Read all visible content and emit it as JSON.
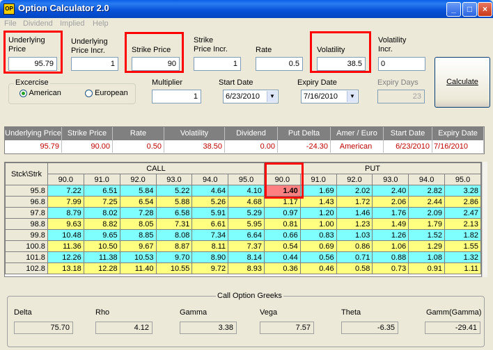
{
  "window": {
    "title": "Option Calculator 2.0",
    "icon_text": "OP",
    "minimize_icon": "minimize-icon",
    "maximize_icon": "maximize-icon",
    "close_icon": "close-icon"
  },
  "menu": [
    "File",
    "Dividend",
    "Implied",
    "Help"
  ],
  "inputs": {
    "underlying_price": {
      "label_line1": "Underlying",
      "label_line2": "Price",
      "value": "95.79"
    },
    "underlying_price_incr": {
      "label_line1": "Underlying",
      "label_line2": "Price Incr.",
      "value": "1"
    },
    "strike_price": {
      "label": "Strike Price",
      "value": "90"
    },
    "strike_price_incr": {
      "label_line1": "Strike",
      "label_line2": "Price Incr.",
      "value": "1"
    },
    "rate": {
      "label": "Rate",
      "value": "0.5"
    },
    "volatility": {
      "label": "Volatility",
      "value": "38.5"
    },
    "volatility_incr": {
      "label_line1": "Volatility",
      "label_line2": "Incr.",
      "value": "0"
    },
    "multiplier": {
      "label": "Multiplier",
      "value": "1"
    },
    "start_date": {
      "label": "Start Date",
      "value": "6/23/2010"
    },
    "expiry_date": {
      "label": "Expiry Date",
      "value": "7/16/2010"
    },
    "expiry_days": {
      "label": "Expiry Days",
      "value": "23"
    }
  },
  "exercise": {
    "label": "Excercise",
    "american": "American",
    "european": "European",
    "selected": "American"
  },
  "calculate_label": "Calculate",
  "summary": {
    "headers": [
      "Underlying Price",
      "Strike Price",
      "Rate",
      "Volatility",
      "Dividend",
      "Put Delta",
      "Amer / Euro",
      "Start Date",
      "Expiry Date"
    ],
    "values": [
      "95.79",
      "90.00",
      "0.50",
      "38.50",
      "0.00",
      "-24.30",
      "American",
      "6/23/2010",
      "7/16/2010"
    ]
  },
  "grid": {
    "corner": "Stck\\Strk",
    "call_label": "CALL",
    "put_label": "PUT",
    "call_strikes": [
      "90.0",
      "91.0",
      "92.0",
      "93.0",
      "94.0",
      "95.0"
    ],
    "put_strikes": [
      "90.0",
      "91.0",
      "92.0",
      "93.0",
      "94.0",
      "95.0"
    ],
    "rows": [
      {
        "stock": "95.8",
        "call": [
          "7.22",
          "6.51",
          "5.84",
          "5.22",
          "4.64",
          "4.10"
        ],
        "put": [
          "1.40",
          "1.69",
          "2.02",
          "2.40",
          "2.82",
          "3.28"
        ]
      },
      {
        "stock": "96.8",
        "call": [
          "7.99",
          "7.25",
          "6.54",
          "5.88",
          "5.26",
          "4.68"
        ],
        "put": [
          "1.17",
          "1.43",
          "1.72",
          "2.06",
          "2.44",
          "2.86"
        ]
      },
      {
        "stock": "97.8",
        "call": [
          "8.79",
          "8.02",
          "7.28",
          "6.58",
          "5.91",
          "5.29"
        ],
        "put": [
          "0.97",
          "1.20",
          "1.46",
          "1.76",
          "2.09",
          "2.47"
        ]
      },
      {
        "stock": "98.8",
        "call": [
          "9.63",
          "8.82",
          "8.05",
          "7.31",
          "6.61",
          "5.95"
        ],
        "put": [
          "0.81",
          "1.00",
          "1.23",
          "1.49",
          "1.79",
          "2.13"
        ]
      },
      {
        "stock": "99.8",
        "call": [
          "10.48",
          "9.65",
          "8.85",
          "8.08",
          "7.34",
          "6.64"
        ],
        "put": [
          "0.66",
          "0.83",
          "1.03",
          "1.26",
          "1.52",
          "1.82"
        ]
      },
      {
        "stock": "100.8",
        "call": [
          "11.36",
          "10.50",
          "9.67",
          "8.87",
          "8.11",
          "7.37"
        ],
        "put": [
          "0.54",
          "0.69",
          "0.86",
          "1.06",
          "1.29",
          "1.55"
        ]
      },
      {
        "stock": "101.8",
        "call": [
          "12.26",
          "11.38",
          "10.53",
          "9.70",
          "8.90",
          "8.14"
        ],
        "put": [
          "0.44",
          "0.56",
          "0.71",
          "0.88",
          "1.08",
          "1.32"
        ]
      },
      {
        "stock": "102.8",
        "call": [
          "13.18",
          "12.28",
          "11.40",
          "10.55",
          "9.72",
          "8.93"
        ],
        "put": [
          "0.36",
          "0.46",
          "0.58",
          "0.73",
          "0.91",
          "1.11"
        ]
      }
    ],
    "colors": {
      "cyan": "#80ffff",
      "yellow": "#ffff80",
      "highlight": "#ff8080",
      "callout": "#ff0000"
    }
  },
  "greeks": {
    "title": "Call Option Greeks",
    "items": [
      {
        "label": "Delta",
        "value": "75.70"
      },
      {
        "label": "Rho",
        "value": "4.12"
      },
      {
        "label": "Gamma",
        "value": "3.38"
      },
      {
        "label": "Vega",
        "value": "7.57"
      },
      {
        "label": "Theta",
        "value": "-6.35"
      },
      {
        "label": "Gamm(Gamma)",
        "value": "-29.41"
      }
    ]
  }
}
